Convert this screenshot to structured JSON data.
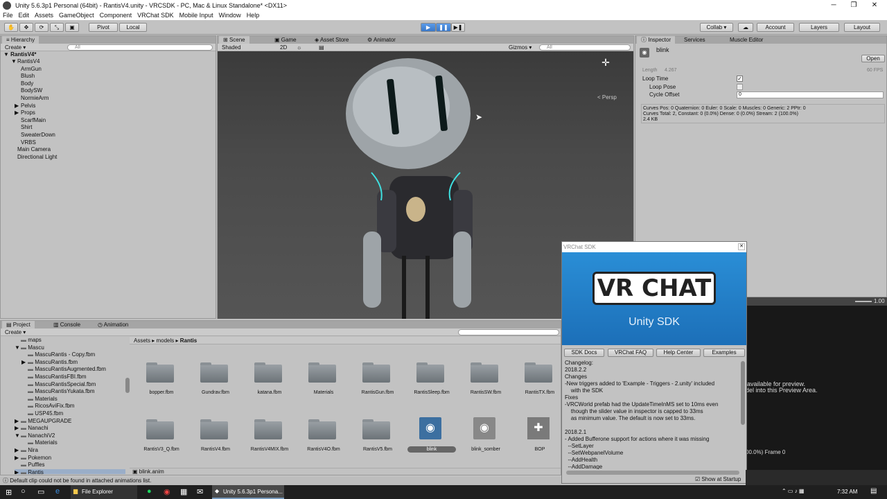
{
  "window": {
    "title": "Unity 5.6.3p1 Personal (64bit) - RantisV4.unity - VRCSDK - PC, Mac & Linux Standalone* <DX11>",
    "minimize": "─",
    "maximize": "❐",
    "close": "✕"
  },
  "menu": [
    "File",
    "Edit",
    "Assets",
    "GameObject",
    "Component",
    "VRChat SDK",
    "Mobile Input",
    "Window",
    "Help"
  ],
  "toolbar": {
    "pivot": "Pivot",
    "local": "Local",
    "collab": "Collab ▾",
    "account": "Account",
    "layers": "Layers",
    "layout": "Layout"
  },
  "hierarchy": {
    "tab": "Hierarchy",
    "create": "Create ▾",
    "search_placeholder": "All",
    "scene": "RantisV4*",
    "items": [
      {
        "label": "RantisV4",
        "indent": 1,
        "arrow": "▼"
      },
      {
        "label": "ArmGun",
        "indent": 2,
        "arrow": ""
      },
      {
        "label": "Blush",
        "indent": 2,
        "arrow": ""
      },
      {
        "label": "Body",
        "indent": 2,
        "arrow": ""
      },
      {
        "label": "BodySW",
        "indent": 2,
        "arrow": ""
      },
      {
        "label": "NormieArm",
        "indent": 2,
        "arrow": ""
      },
      {
        "label": "Pelvis",
        "indent": 2,
        "arrow": "▶"
      },
      {
        "label": "Props",
        "indent": 2,
        "arrow": "▶"
      },
      {
        "label": "ScarfMain",
        "indent": 2,
        "arrow": ""
      },
      {
        "label": "Shirt",
        "indent": 2,
        "arrow": ""
      },
      {
        "label": "SweaterDown",
        "indent": 2,
        "arrow": ""
      },
      {
        "label": "VRBS",
        "indent": 2,
        "arrow": ""
      },
      {
        "label": "Main Camera",
        "indent": 1,
        "arrow": ""
      },
      {
        "label": "Directional Light",
        "indent": 1,
        "arrow": ""
      }
    ]
  },
  "scene": {
    "tabs": [
      "Scene",
      "Game",
      "Asset Store",
      "Animator"
    ],
    "shading": "Shaded",
    "mode2d": "2D",
    "gizmos": "Gizmos ▾",
    "search_placeholder": "All",
    "persp": "< Persp"
  },
  "inspector": {
    "tabs": [
      "Inspector",
      "Services",
      "Muscle Editor"
    ],
    "name": "blink",
    "open": "Open",
    "length_label": "Length",
    "length_value": "4.267",
    "fps": "60 FPS",
    "loop_time": "Loop Time",
    "loop_pose": "Loop Pose",
    "cycle_offset": "Cycle Offset",
    "cycle_offset_value": "0",
    "curves1": "Curves Pos: 0 Quaternion: 0 Euler: 0 Scale: 0 Muscles: 0 Generic: 2 PPtr: 0",
    "curves2": "Curves Total: 2, Constant: 0 (0.0%) Dense: 0 (0.0%) Stream: 2 (100.0%)",
    "size": "2.4 KB",
    "speed": "1.00",
    "preview1": "available for preview.",
    "preview2": "del into this Preview Area.",
    "frame": "00.0%) Frame 0"
  },
  "sdk": {
    "title": "VRChat SDK",
    "logo": "VR CHAT",
    "subtitle": "Unity SDK",
    "buttons": [
      "SDK Docs",
      "VRChat FAQ",
      "Help Center",
      "Examples"
    ],
    "changelog": "Changelog:\n2018.2.2\nChanges\n-New triggers added to 'Example - Triggers - 2.unity' included\n    with the SDK\nFixes\n-VRCWorld prefab had the UpdateTimeInMS set to 10ms even\n    though the slider value in inspector is capped to 33ms\n    as minimum value. The default is now set to 33ms.\n\n2018.2.1\n- Added Bufferone support for actions where it was missing\n  --SetLayer\n  --SetWebpanelVolume\n  --AddHealth\n  --AddDamage\n  --SetComponentActive\n  --SetMaterial",
    "show_startup": "Show at Startup"
  },
  "project": {
    "tabs": [
      "Project",
      "Console",
      "Animation"
    ],
    "create": "Create ▾",
    "breadcrumb": [
      "Assets",
      "models",
      "Rantis"
    ],
    "tree": [
      {
        "label": "maps",
        "indent": 2,
        "arrow": ""
      },
      {
        "label": "Mascu",
        "indent": 2,
        "arrow": "▼"
      },
      {
        "label": "MascuRantis - Copy.fbm",
        "indent": 3,
        "arrow": ""
      },
      {
        "label": "MascuRantis.fbm",
        "indent": 3,
        "arrow": "▶"
      },
      {
        "label": "MascuRantisAugmented.fbm",
        "indent": 3,
        "arrow": ""
      },
      {
        "label": "MascuRantisFBI.fbm",
        "indent": 3,
        "arrow": ""
      },
      {
        "label": "MascuRantisSpecial.fbm",
        "indent": 3,
        "arrow": ""
      },
      {
        "label": "MascuRantisYukata.fbm",
        "indent": 3,
        "arrow": ""
      },
      {
        "label": "Materials",
        "indent": 3,
        "arrow": ""
      },
      {
        "label": "RicosAviFix.fbm",
        "indent": 3,
        "arrow": ""
      },
      {
        "label": "USP45.fbm",
        "indent": 3,
        "arrow": ""
      },
      {
        "label": "MEGAUPGRADE",
        "indent": 2,
        "arrow": "▶"
      },
      {
        "label": "Nanachi",
        "indent": 2,
        "arrow": "▶"
      },
      {
        "label": "NanachiV2",
        "indent": 2,
        "arrow": "▼"
      },
      {
        "label": "Materials",
        "indent": 3,
        "arrow": ""
      },
      {
        "label": "Nira",
        "indent": 2,
        "arrow": "▶"
      },
      {
        "label": "Pokemon",
        "indent": 2,
        "arrow": "▶"
      },
      {
        "label": "Puffles",
        "indent": 2,
        "arrow": ""
      },
      {
        "label": "Rantis",
        "indent": 2,
        "arrow": "▶"
      }
    ],
    "assets_row1": [
      "bopper.fbm",
      "Gundrav.fbm",
      "katana.fbm",
      "Materials",
      "RantisGun.fbm",
      "RantisSleep.fbm",
      "RantisSW.fbm",
      "RantisTX.fbm"
    ],
    "assets_row2": [
      "RantisV3_Q.fbm",
      "RantisV4.fbm",
      "RantisV4MIX.fbm",
      "RantisV4O.fbm",
      "RantisV5.fbm",
      "blink",
      "blink_somber",
      "BOP"
    ],
    "selected_file": "blink.anim"
  },
  "status": "Default clip could not be found in attached animations list.",
  "taskbar": {
    "explorer": "File Explorer",
    "unity": "Unity 5.6.3p1 Persona...",
    "time": "7:32 AM"
  }
}
